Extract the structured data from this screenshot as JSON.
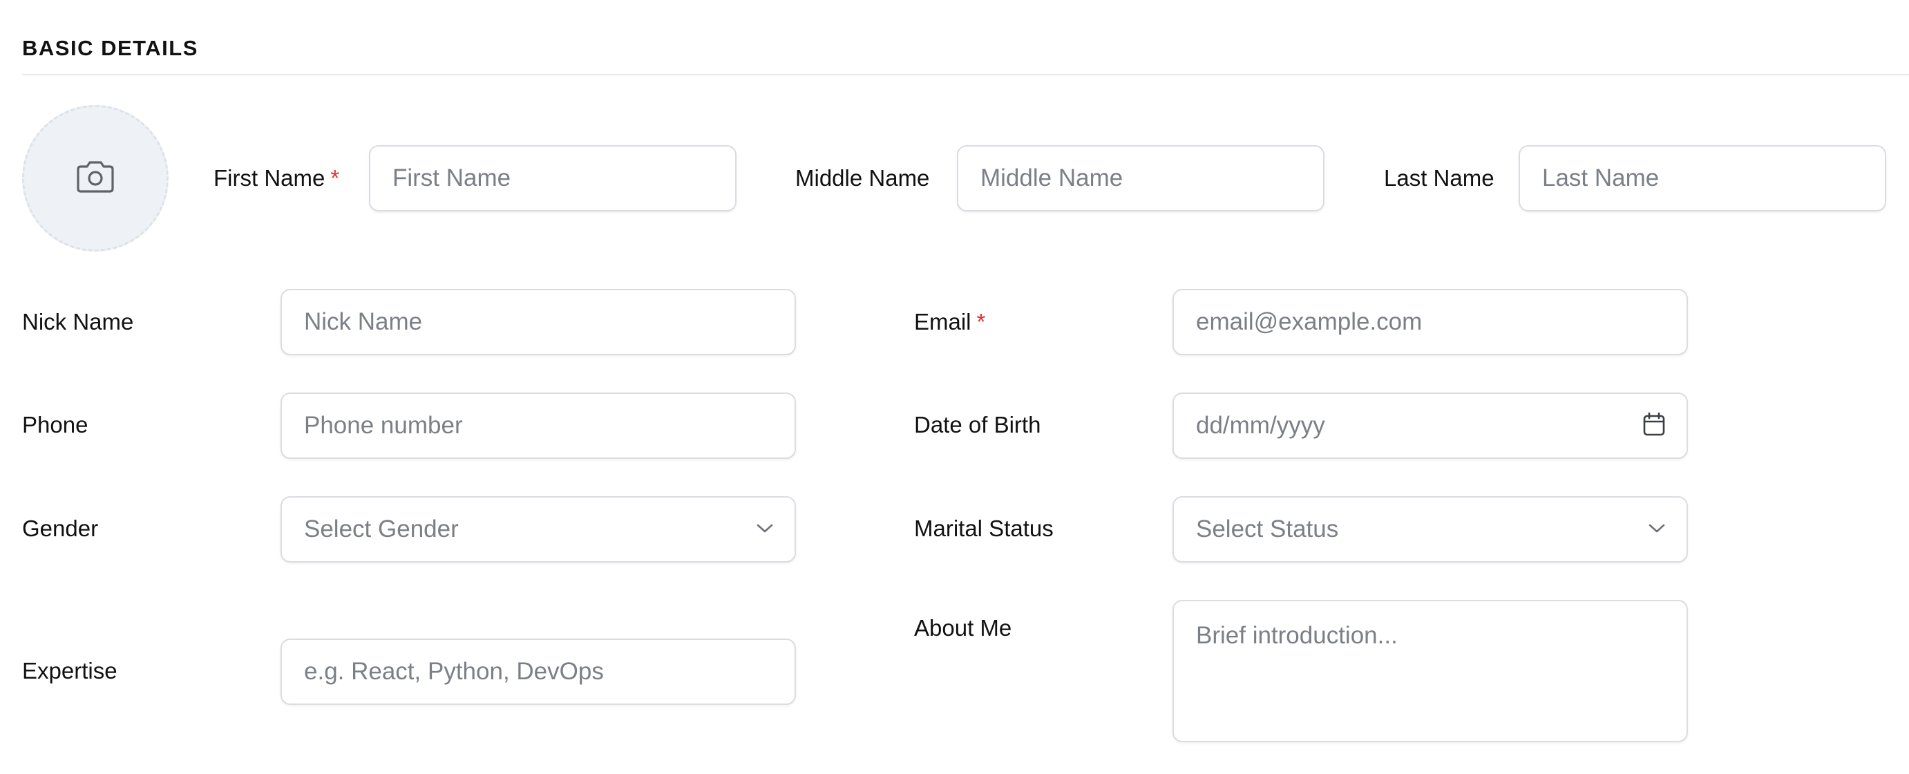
{
  "section": {
    "title": "BASIC DETAILS"
  },
  "avatar": {
    "icon": "camera-icon"
  },
  "fields": {
    "first_name": {
      "label": "First Name",
      "required_mark": "*",
      "placeholder": "First Name",
      "value": ""
    },
    "middle_name": {
      "label": "Middle Name",
      "placeholder": "Middle Name",
      "value": ""
    },
    "last_name": {
      "label": "Last Name",
      "placeholder": "Last Name",
      "value": ""
    },
    "nick_name": {
      "label": "Nick Name",
      "placeholder": "Nick Name",
      "value": ""
    },
    "email": {
      "label": "Email",
      "required_mark": "*",
      "placeholder": "email@example.com",
      "value": ""
    },
    "phone": {
      "label": "Phone",
      "placeholder": "Phone number",
      "value": ""
    },
    "date_of_birth": {
      "label": "Date of Birth",
      "placeholder": "dd/mm/yyyy",
      "icon": "calendar-icon"
    },
    "gender": {
      "label": "Gender",
      "selected": "Select Gender",
      "icon": "chevron-down-icon"
    },
    "marital_status": {
      "label": "Marital Status",
      "selected": "Select Status",
      "icon": "chevron-down-icon"
    },
    "expertise": {
      "label": "Expertise",
      "placeholder": "e.g. React, Python, DevOps",
      "value": ""
    },
    "about_me": {
      "label": "About Me",
      "placeholder": "Brief introduction...",
      "value": ""
    }
  },
  "colors": {
    "required": "#e03131",
    "border": "#d9dce1",
    "placeholder": "#7b7f86",
    "avatar_bg": "#eef2f6"
  }
}
